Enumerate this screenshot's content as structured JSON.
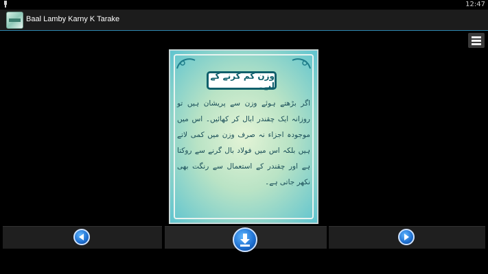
{
  "statusbar": {
    "clock": "12:47"
  },
  "actionbar": {
    "title": "Baal Lamby Karny K Tarake"
  },
  "card": {
    "title": "وزن کم کرنے کے لیے۔",
    "body": "اگر بڑھتے ہوئے وزن سے پریشان ہیں تو روزانہ ایک چقندر ابال کر کھائیں۔ اس میں موجودہ اجزاء نہ صرف وزن میں کمی لاتے ہیں بلکہ اس میں فولاد بال گرنے سے روکتا ہے اور چقندر کے استعمال سے رنگت بھی نکھر جاتی ہے۔"
  },
  "icons": {
    "app": "app-logo-icon",
    "menu": "menu-icon",
    "prev": "previous-arrow-icon",
    "next": "next-arrow-icon",
    "download": "download-icon"
  },
  "colors": {
    "accent": "#2d87b0",
    "title_border": "#0e5f6b",
    "button_blue": "#1e6fd0"
  }
}
